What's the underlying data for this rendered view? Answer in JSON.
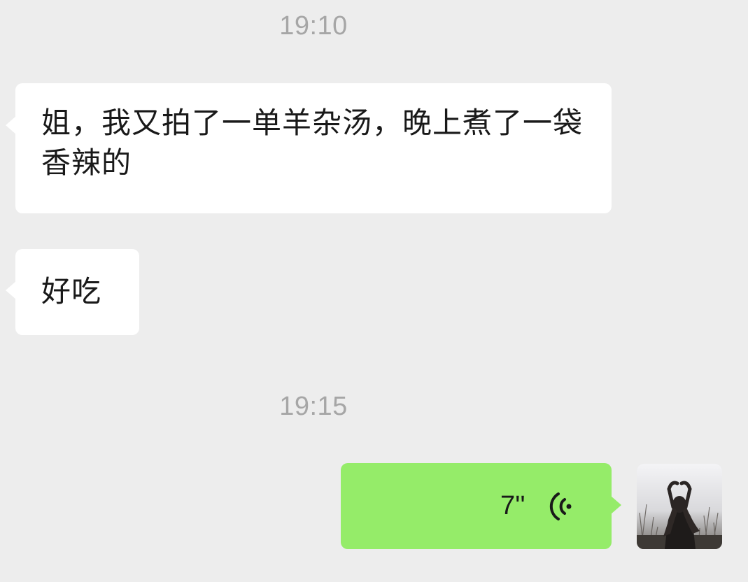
{
  "chat": {
    "timestamps": [
      "19:10",
      "19:15"
    ],
    "messages": [
      {
        "side": "left",
        "type": "text",
        "text": "姐，我又拍了一单羊杂汤，晚上煮了一袋香辣的"
      },
      {
        "side": "left",
        "type": "text",
        "text": "好吃"
      },
      {
        "side": "right",
        "type": "voice",
        "duration": "7''",
        "icon": "voice-waves-icon"
      }
    ]
  },
  "colors": {
    "background": "#ededed",
    "incoming_bubble": "#ffffff",
    "outgoing_bubble": "#95ec69",
    "timestamp": "#a6a6a6"
  }
}
